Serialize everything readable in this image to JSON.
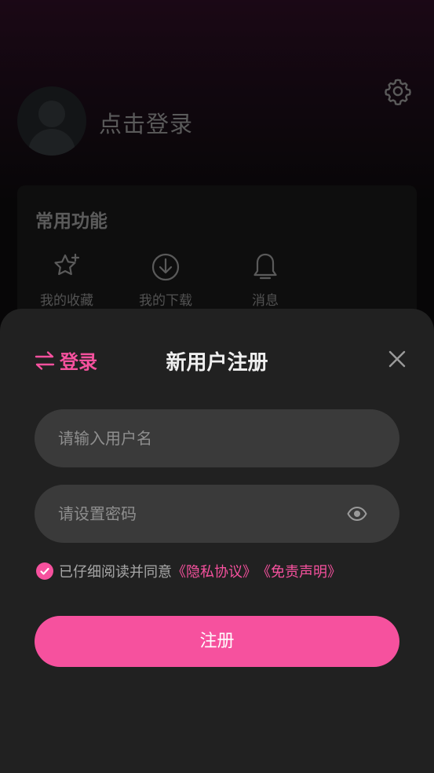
{
  "colors": {
    "accent": "#f6519e",
    "sheet_bg": "#212121",
    "input_bg": "#3a3a3a"
  },
  "header": {
    "login_prompt": "点击登录",
    "settings_icon": "gear-icon",
    "avatar_icon": "avatar-placeholder"
  },
  "functions": {
    "title": "常用功能",
    "items": [
      {
        "label": "我的收藏",
        "icon": "star-icon"
      },
      {
        "label": "我的下载",
        "icon": "download-icon"
      },
      {
        "label": "消息",
        "icon": "bell-icon"
      }
    ]
  },
  "register_sheet": {
    "switch_label": "登录",
    "switch_icon": "swap-arrows-icon",
    "title": "新用户注册",
    "close_icon": "close-icon",
    "username_placeholder": "请输入用户名",
    "username_value": "",
    "password_placeholder": "请设置密码",
    "password_value": "",
    "password_toggle_icon": "eye-icon",
    "agree_checked": true,
    "agree_text": "已仔细阅读并同意",
    "privacy_link": "《隐私协议》",
    "disclaimer_link": "《免责声明》",
    "submit_label": "注册"
  }
}
